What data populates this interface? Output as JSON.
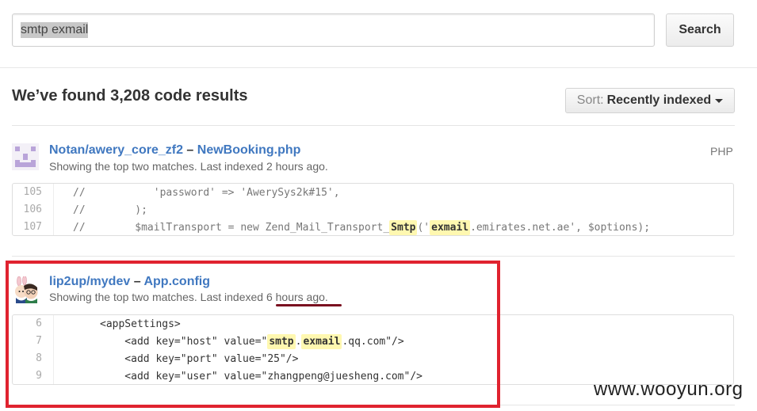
{
  "search": {
    "query": "smtp exmail",
    "button_label": "Search"
  },
  "results_header": {
    "title": "We’ve found 3,208 code results",
    "sort_label": "Sort:",
    "sort_value": "Recently indexed"
  },
  "results": [
    {
      "repo": "Notan/awery_core_zf2",
      "dash": "–",
      "file": "NewBooking.php",
      "meta": "Showing the top two matches. Last indexed 2 hours ago.",
      "language": "PHP",
      "lines": [
        {
          "num": "105",
          "segments": [
            "//           'password' => 'AwerySys2k#15',"
          ]
        },
        {
          "num": "106",
          "segments": [
            "//        );"
          ]
        },
        {
          "num": "107",
          "segments": [
            "//        $mailTransport = new Zend_Mail_Transport_",
            "Smtp",
            "('",
            "exmail",
            ".emirates.net.ae', $options);"
          ]
        }
      ]
    },
    {
      "repo": "lip2up/mydev",
      "dash": "–",
      "file": "App.config",
      "meta_prefix": "Showing the top two matches. Last indexed ",
      "meta_time": "6 hours ago",
      "meta_suffix": ".",
      "lines": [
        {
          "num": "6",
          "segments": [
            "<appSettings>"
          ]
        },
        {
          "num": "7",
          "segments": [
            "    <add key=\"host\" value=\"",
            "smtp",
            ".",
            "exmail",
            ".qq.com\"/>"
          ]
        },
        {
          "num": "8",
          "segments": [
            "    <add key=\"port\" value=\"25\"/>"
          ]
        },
        {
          "num": "9",
          "segments": [
            "    <add key=\"user\" value=\"zhangpeng@juesheng.com\"/>"
          ]
        }
      ]
    }
  ],
  "watermark": "www.wooyun.org"
}
